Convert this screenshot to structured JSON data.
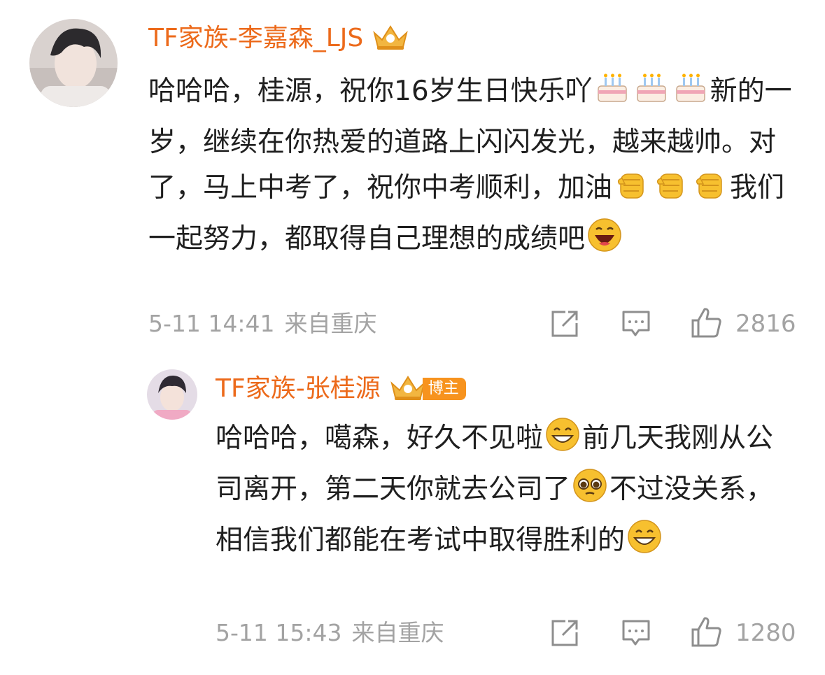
{
  "comments": [
    {
      "username": "TF家族-李嘉森_LJS",
      "text_parts": [
        "哈哈哈，桂源，祝你16岁生日快乐吖",
        "新的一岁，继续在你热爱的道路上闪闪发光，越来越帅。对了，马上中考了，祝你中考顺利，加油",
        "我们一起努力，都取得自己理想的成绩吧"
      ],
      "date": "5-11 14:41",
      "location": "来自重庆",
      "likes": "2816",
      "emojis": [
        "cake-icon",
        "cake-icon",
        "cake-icon",
        "fist-icon",
        "fist-icon",
        "fist-icon",
        "laughing-face-icon"
      ]
    },
    {
      "username": "TF家族-张桂源",
      "badge": "博主",
      "text_parts": [
        "哈哈哈，噶森，好久不见啦",
        "前几天我刚从公司离开，第二天你就去公司了",
        "不过没关系，相信我们都能在考试中取得胜利的"
      ],
      "date": "5-11 15:43",
      "location": "来自重庆",
      "likes": "1280",
      "emojis": [
        "grinning-face-icon",
        "pleading-face-icon",
        "grinning-face-icon"
      ]
    }
  ],
  "colors": {
    "username": "#ec6a1b",
    "meta": "#a3a3a3",
    "badge": "#f7931e"
  }
}
